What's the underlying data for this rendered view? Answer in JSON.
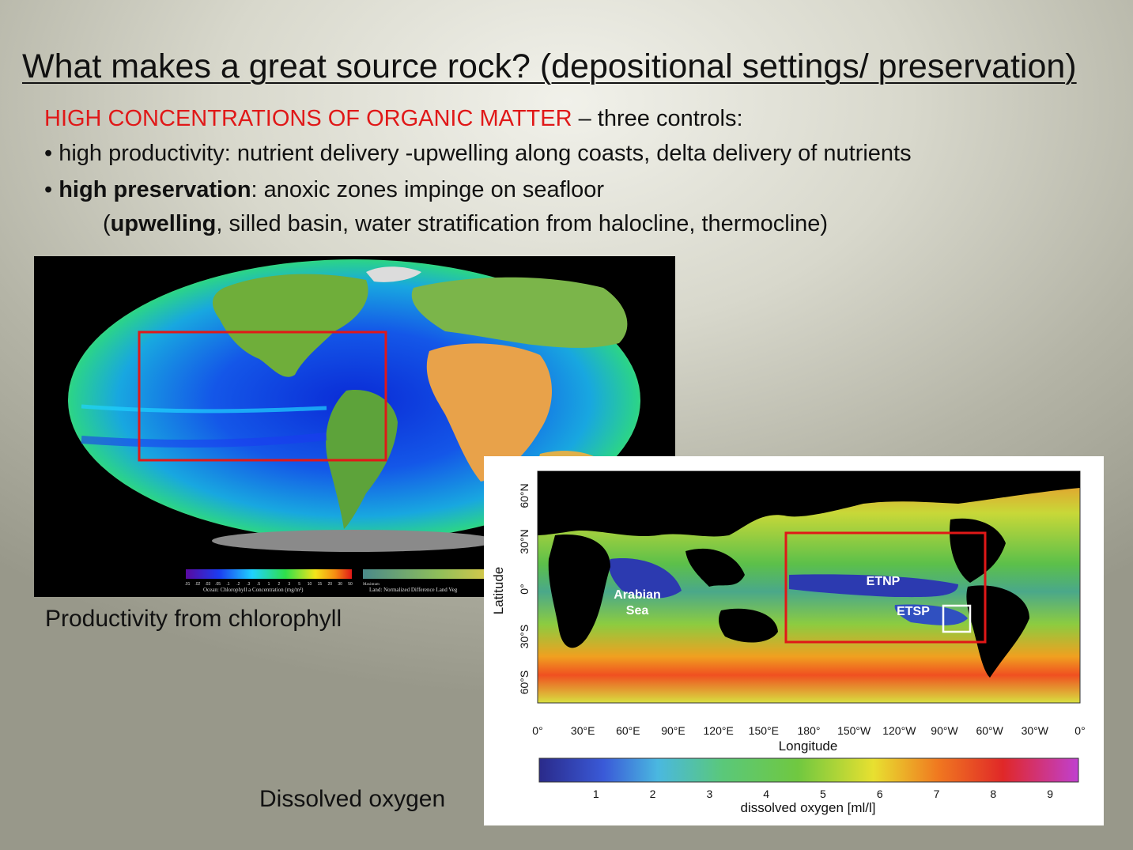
{
  "slide": {
    "title": "What makes a great source rock? (depositional settings/ preservation)",
    "line1_red": "HIGH CONCENTRATIONS OF ORGANIC MATTER",
    "line1_rest": " – three controls:",
    "bullet1": "• high productivity: nutrient delivery -upwelling along coasts, delta delivery of nutrients",
    "bullet2_prefix": "• ",
    "bullet2_bold": "high preservation",
    "bullet2_rest": ": anoxic zones impinge on seafloor",
    "bullet3_open": "(",
    "bullet3_bold": "upwelling",
    "bullet3_rest": ", silled basin, water stratification from halocline, thermocline)"
  },
  "chlorophyll_map": {
    "caption": "Productivity from chlorophyll",
    "legend_ocean": "Ocean: Chlorophyll a Concentration (mg/m³)",
    "legend_land": "Land: Normalized Difference Land Veg",
    "legend_ticks": [
      ".01",
      ".02",
      ".03",
      ".05",
      ".1",
      ".2",
      ".3",
      ".5",
      "1",
      "2",
      "3",
      "5",
      "10",
      "15",
      "20",
      "30",
      "50"
    ],
    "legend_land_max": "Maximum"
  },
  "oxygen_map": {
    "caption": "Dissolved oxygen",
    "y_label": "Latitude",
    "x_label": "Longitude",
    "lat_ticks": [
      "60°N",
      "30°N",
      "0°",
      "30°S",
      "60°S"
    ],
    "lon_ticks": [
      "0°",
      "30°E",
      "60°E",
      "90°E",
      "120°E",
      "150°E",
      "180°",
      "150°W",
      "120°W",
      "90°W",
      "60°W",
      "30°W",
      "0°"
    ],
    "region_arabian": [
      "Arabian",
      "Sea"
    ],
    "region_etnp": "ETNP",
    "region_etsp": "ETSP",
    "colorbar_label": "dissolved oxygen [ml/l]",
    "colorbar_ticks": [
      "1",
      "2",
      "3",
      "4",
      "5",
      "6",
      "7",
      "8",
      "9"
    ],
    "highlight_color": "#e01818"
  }
}
